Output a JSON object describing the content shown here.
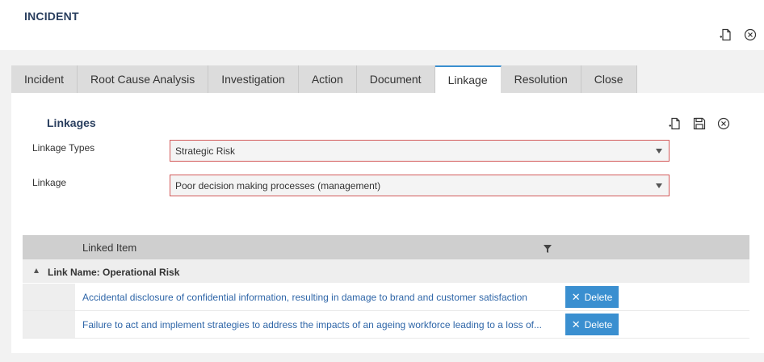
{
  "header": {
    "title": "INCIDENT"
  },
  "tabs": [
    {
      "label": "Incident"
    },
    {
      "label": "Root Cause Analysis"
    },
    {
      "label": "Investigation"
    },
    {
      "label": "Action"
    },
    {
      "label": "Document"
    },
    {
      "label": "Linkage",
      "active": true
    },
    {
      "label": "Resolution"
    },
    {
      "label": "Close"
    }
  ],
  "linkages": {
    "title": "Linkages",
    "fields": {
      "linkage_types": {
        "label": "Linkage Types",
        "value": "Strategic Risk"
      },
      "linkage": {
        "label": "Linkage",
        "value": "Poor decision making processes (management)"
      }
    }
  },
  "grid": {
    "column_header": "Linked Item",
    "group_label": "Link Name: Operational Risk",
    "rows": [
      {
        "text": "Accidental disclosure of confidential information, resulting in damage to brand and customer satisfaction",
        "action": "Delete"
      },
      {
        "text": "Failure to act and implement strategies to address the impacts of an ageing workforce leading to a loss of...",
        "action": "Delete"
      }
    ]
  },
  "colors": {
    "accent": "#3a8fd0",
    "invalid_border": "#d25a5a",
    "title": "#2a3f5f",
    "link": "#2f66a8"
  },
  "icons": [
    "add-document-icon",
    "close-circle-icon",
    "save-icon",
    "filter-icon"
  ]
}
